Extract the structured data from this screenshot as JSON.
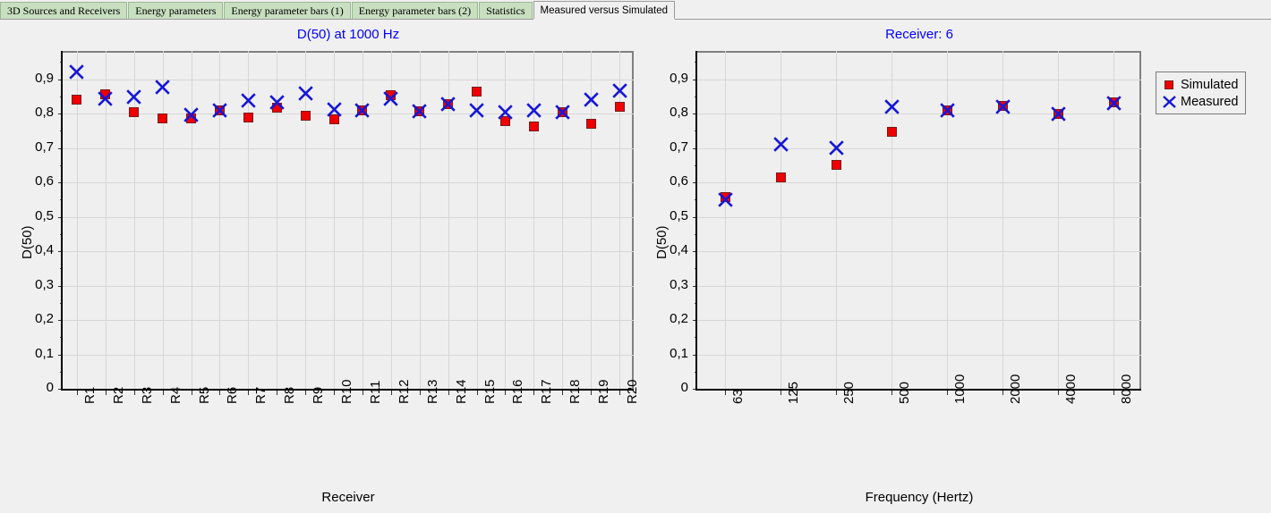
{
  "window": {
    "background": "#f0f0f0"
  },
  "tabs": {
    "items": [
      {
        "label": "3D Sources and Receivers",
        "active": false
      },
      {
        "label": "Energy parameters",
        "active": false
      },
      {
        "label": "Energy parameter bars (1)",
        "active": false
      },
      {
        "label": "Energy parameter bars (2)",
        "active": false
      },
      {
        "label": "Statistics",
        "active": false
      },
      {
        "label": "Measured versus Simulated",
        "active": true
      }
    ],
    "inactive_color": "#c8dfc0",
    "active_color": "#f0f0f0"
  },
  "legend": {
    "entries": [
      {
        "label": "Simulated",
        "marker": "square",
        "color": "#ee0000"
      },
      {
        "label": "Measured",
        "marker": "cross",
        "color": "#1616d8"
      }
    ]
  },
  "colors": {
    "simulated": "#ee0000",
    "measured": "#1616d8",
    "title": "#0000ff",
    "grid": "#d6d6d6",
    "plot_bg": "#efefef"
  },
  "chart_data": [
    {
      "id": "left",
      "type": "scatter",
      "title": "D(50) at 1000 Hz",
      "xlabel": "Receiver",
      "ylabel": "D(50)",
      "ylim": [
        0,
        0.982
      ],
      "yticks": [
        0,
        0.1,
        0.2,
        0.3,
        0.4,
        0.5,
        0.6,
        0.7,
        0.8,
        0.9
      ],
      "ytick_labels": [
        "0",
        "0,1",
        "0,2",
        "0,3",
        "0,4",
        "0,5",
        "0,6",
        "0,7",
        "0,8",
        "0,9"
      ],
      "grid": true,
      "categories": [
        "R1",
        "R2",
        "R3",
        "R4",
        "R5",
        "R6",
        "R7",
        "R8",
        "R9",
        "R10",
        "R11",
        "R12",
        "R13",
        "R14",
        "R15",
        "R16",
        "R17",
        "R18",
        "R19",
        "R20"
      ],
      "series": [
        {
          "name": "Simulated",
          "marker": "square",
          "color": "#ee0000",
          "values": [
            0.84,
            0.855,
            0.803,
            0.785,
            0.787,
            0.81,
            0.788,
            0.817,
            0.794,
            0.784,
            0.81,
            0.853,
            0.807,
            0.827,
            0.863,
            0.777,
            0.762,
            0.803,
            0.77,
            0.82
          ]
        },
        {
          "name": "Measured",
          "marker": "cross",
          "color": "#1616d8",
          "values": [
            0.92,
            0.842,
            0.848,
            0.877,
            0.797,
            0.81,
            0.838,
            0.832,
            0.858,
            0.812,
            0.81,
            0.843,
            0.807,
            0.828,
            0.808,
            0.803,
            0.81,
            0.803,
            0.84,
            0.867
          ]
        }
      ]
    },
    {
      "id": "right",
      "type": "scatter",
      "title": "Receiver: 6",
      "xlabel": "Frequency (Hertz)",
      "ylabel": "D(50)",
      "ylim": [
        0,
        0.982
      ],
      "yticks": [
        0,
        0.1,
        0.2,
        0.3,
        0.4,
        0.5,
        0.6,
        0.7,
        0.8,
        0.9
      ],
      "ytick_labels": [
        "0",
        "0,1",
        "0,2",
        "0,3",
        "0,4",
        "0,5",
        "0,6",
        "0,7",
        "0,8",
        "0,9"
      ],
      "grid": true,
      "categories": [
        "63",
        "125",
        "250",
        "500",
        "1000",
        "2000",
        "4000",
        "8000"
      ],
      "series": [
        {
          "name": "Simulated",
          "marker": "square",
          "color": "#ee0000",
          "values": [
            0.556,
            0.615,
            0.65,
            0.748,
            0.81,
            0.823,
            0.8,
            0.832
          ]
        },
        {
          "name": "Measured",
          "marker": "cross",
          "color": "#1616d8",
          "values": [
            0.55,
            0.71,
            0.7,
            0.82,
            0.81,
            0.82,
            0.8,
            0.83
          ]
        }
      ]
    }
  ]
}
